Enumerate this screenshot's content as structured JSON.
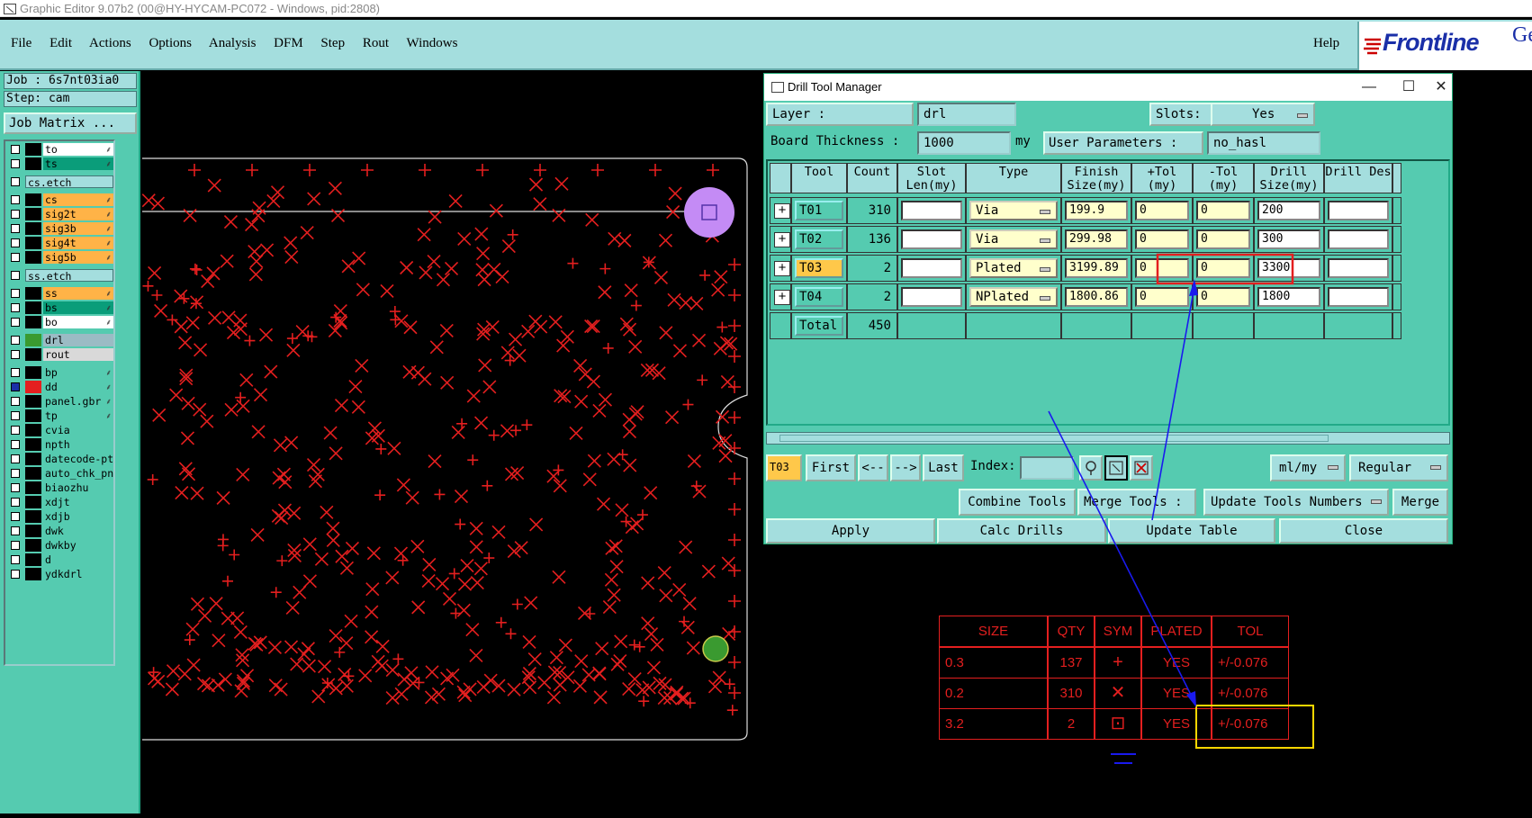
{
  "window": {
    "title": "Graphic Editor 9.07b2 (00@HY-HYCAM-PC072 - Windows, pid:2808)"
  },
  "menu": {
    "items": [
      "File",
      "Edit",
      "Actions",
      "Options",
      "Analysis",
      "DFM",
      "Step",
      "Rout",
      "Windows"
    ],
    "help": "Help"
  },
  "logo": {
    "brand": "Frontline",
    "brand2": "Ge"
  },
  "job": {
    "job_line": "Job : 6s7nt03ia0",
    "step_line": "Step: cam",
    "matrix_button": "Job Matrix ..."
  },
  "layers": [
    {
      "name": "to",
      "color": "#ffffff",
      "marker": "⸙"
    },
    {
      "name": "ts",
      "color": "#0a9d7a",
      "marker": "⸙"
    },
    {
      "name": "cs.etch",
      "color": "",
      "marker": ""
    },
    {
      "name": "cs",
      "color": "#ffb347",
      "marker": "⸙"
    },
    {
      "name": "sig2t",
      "color": "#ffb347",
      "marker": "⸙"
    },
    {
      "name": "sig3b",
      "color": "#ffb347",
      "marker": "⸙"
    },
    {
      "name": "sig4t",
      "color": "#ffb347",
      "marker": "⸙"
    },
    {
      "name": "sig5b",
      "color": "#ffb347",
      "marker": "⸙"
    },
    {
      "name": "ss.etch",
      "color": "",
      "marker": ""
    },
    {
      "name": "ss",
      "color": "#ffb347",
      "marker": "⸙"
    },
    {
      "name": "bs",
      "color": "#0a9d7a",
      "marker": "⸙"
    },
    {
      "name": "bo",
      "color": "#ffffff",
      "marker": "⸙"
    },
    {
      "name": "drl",
      "color": "#9bbbc4",
      "marker": ""
    },
    {
      "name": "rout",
      "color": "#d9d9d9",
      "marker": ""
    },
    {
      "name": "bp",
      "color": "#55cbb0",
      "marker": "⸙"
    },
    {
      "name": "dd",
      "color": "#55cbb0",
      "marker": "⸙"
    },
    {
      "name": "panel.gbr",
      "color": "#55cbb0",
      "marker": "⸙"
    },
    {
      "name": "tp",
      "color": "#55cbb0",
      "marker": "⸙"
    },
    {
      "name": "cvia",
      "color": "#55cbb0",
      "marker": ""
    },
    {
      "name": "npth",
      "color": "#55cbb0",
      "marker": ""
    },
    {
      "name": "datecode-pte",
      "color": "#55cbb0",
      "marker": ""
    },
    {
      "name": "auto_chk_pn",
      "color": "#55cbb0",
      "marker": ""
    },
    {
      "name": "biaozhu",
      "color": "#55cbb0",
      "marker": ""
    },
    {
      "name": "xdjt",
      "color": "#55cbb0",
      "marker": ""
    },
    {
      "name": "xdjb",
      "color": "#55cbb0",
      "marker": ""
    },
    {
      "name": "dwk",
      "color": "#55cbb0",
      "marker": ""
    },
    {
      "name": "dwkby",
      "color": "#55cbb0",
      "marker": ""
    },
    {
      "name": "d",
      "color": "#55cbb0",
      "marker": ""
    },
    {
      "name": "ydkdrl",
      "color": "#55cbb0",
      "marker": ""
    }
  ],
  "dialog": {
    "title": "Drill Tool Manager",
    "window_buttons": [
      "—",
      "☐",
      "✕"
    ],
    "layer_label": "Layer         :",
    "layer_value": "drl",
    "slots_label": "Slots:",
    "slots_value": "Yes",
    "board_thickness_label": "Board Thickness :",
    "board_thickness_value": "1000",
    "board_thickness_unit": "my",
    "user_params_label": "User Parameters :",
    "user_params_value": "no_hasl",
    "columns": [
      "Tool",
      "Count",
      "Slot Len(my)",
      "Type",
      "Finish Size(my)",
      "+Tol (my)",
      "-Tol (my)",
      "Drill Size(my)",
      "Drill Des"
    ],
    "rows": [
      {
        "tool": "T01",
        "count": "310",
        "slot_len": "",
        "type": "Via",
        "finish": "199.9",
        "plus_tol": "0",
        "minus_tol": "0",
        "drill": "200",
        "des": ""
      },
      {
        "tool": "T02",
        "count": "136",
        "slot_len": "",
        "type": "Via",
        "finish": "299.98",
        "plus_tol": "0",
        "minus_tol": "0",
        "drill": "300",
        "des": ""
      },
      {
        "tool": "T03",
        "count": "2",
        "slot_len": "",
        "type": "Plated",
        "finish": "3199.89",
        "plus_tol": "0",
        "minus_tol": "0",
        "drill": "3300",
        "des": ""
      },
      {
        "tool": "T04",
        "count": "2",
        "slot_len": "",
        "type": "NPlated",
        "finish": "1800.86",
        "plus_tol": "0",
        "minus_tol": "0",
        "drill": "1800",
        "des": ""
      }
    ],
    "total_label": "Total",
    "total_count": "450",
    "current_tool": "T03",
    "nav": {
      "first": "First",
      "prev": "<--",
      "next": "-->",
      "last": "Last",
      "index_label": "Index:",
      "index_value": ""
    },
    "units_value": "ml/my",
    "mode_value": "Regular",
    "combine_tools": "Combine Tools",
    "merge_tools_label": "Merge Tools :",
    "merge_tools_value": "Update Tools Numbers",
    "merge_button": "Merge",
    "apply": "Apply",
    "calc_drills": "Calc Drills",
    "update_table": "Update Table",
    "close": "Close"
  },
  "drawing_table": {
    "headers": [
      "SIZE",
      "QTY",
      "SYM",
      "PLATED",
      "TOL"
    ],
    "rows": [
      {
        "size": "0.3",
        "qty": "137",
        "sym": "+",
        "plated": "YES",
        "tol": "+/-0.076"
      },
      {
        "size": "0.2",
        "qty": "310",
        "sym": "✕",
        "plated": "YES",
        "tol": "+/-0.076"
      },
      {
        "size": "3.2",
        "qty": "2",
        "sym": "⊡",
        "plated": "YES",
        "tol": "+/-0.076"
      }
    ]
  },
  "colors": {
    "panel_teal": "#55cbb0",
    "light_teal": "#a4dede",
    "drill_red": "#e41f1f",
    "highlight_yellow": "#ffd700",
    "arrow_blue": "#1a1aee",
    "selected_tool": "#ffc84a"
  }
}
